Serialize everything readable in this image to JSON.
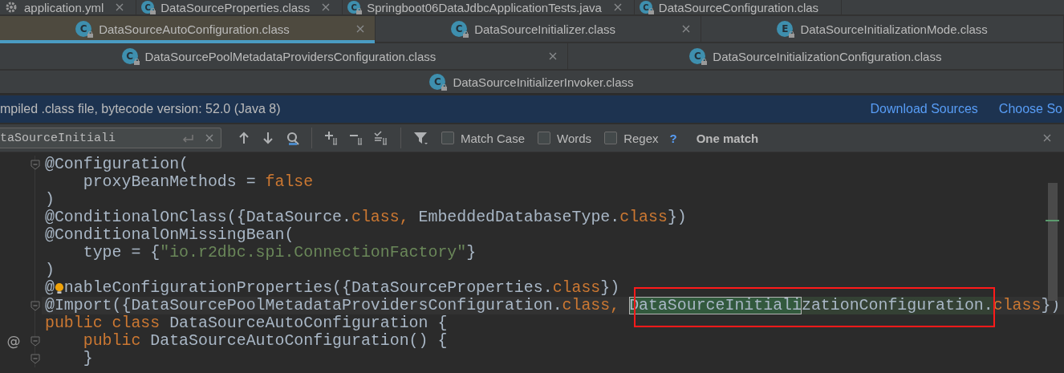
{
  "tab_rows": [
    [
      {
        "label": "application.yml",
        "kind": "config",
        "selected": false,
        "closable": true
      },
      {
        "label": "DataSourceProperties.class",
        "kind": "class",
        "badge": "C",
        "selected": false,
        "closable": true
      },
      {
        "label": "Springboot06DataJdbcApplicationTests.java",
        "kind": "class",
        "badge": "C",
        "selected": false,
        "closable": true
      },
      {
        "label": "DataSourceConfiguration.clas",
        "kind": "class",
        "badge": "C",
        "selected": false,
        "closable": false
      }
    ],
    [
      {
        "label": "DataSourceAutoConfiguration.class",
        "kind": "class",
        "badge": "C",
        "selected": true,
        "closable": true
      },
      {
        "label": "DataSourceInitializer.class",
        "kind": "class",
        "badge": "C",
        "selected": false,
        "closable": true
      },
      {
        "label": "DataSourceInitializationMode.class",
        "kind": "enum",
        "badge": "E",
        "selected": false,
        "closable": false
      }
    ],
    [
      {
        "label": "DataSourcePoolMetadataProvidersConfiguration.class",
        "kind": "class",
        "badge": "C",
        "selected": false,
        "closable": true
      },
      {
        "label": "DataSourceInitializationConfiguration.class",
        "kind": "class",
        "badge": "C",
        "selected": false,
        "closable": false
      }
    ],
    [
      {
        "label": "DataSourceInitializerInvoker.class",
        "kind": "class",
        "badge": "C",
        "selected": false,
        "closable": false
      }
    ]
  ],
  "banner": {
    "message": "mpiled .class file, bytecode version: 52.0 (Java 8)",
    "links": [
      "Download Sources",
      "Choose So"
    ]
  },
  "find_bar": {
    "value": "taSourceInitiali",
    "options": [
      {
        "label": "Match Case",
        "checked": false
      },
      {
        "label": "Words",
        "checked": false
      },
      {
        "label": "Regex",
        "checked": false
      }
    ],
    "help": "?",
    "status": "One match"
  },
  "code": {
    "lines": [
      {
        "fold": true,
        "current": false,
        "tokens": [
          {
            "kind": "plain",
            "text": "@Configuration("
          }
        ]
      },
      {
        "fold": false,
        "current": false,
        "tokens": [
          {
            "kind": "plain",
            "text": "    proxyBeanMethods = "
          },
          {
            "kind": "keyword",
            "text": "false"
          }
        ]
      },
      {
        "fold": false,
        "current": false,
        "tokens": [
          {
            "kind": "plain",
            "text": ")"
          }
        ]
      },
      {
        "fold": false,
        "current": false,
        "tokens": [
          {
            "kind": "plain",
            "text": "@ConditionalOnClass({DataSource."
          },
          {
            "kind": "keyword",
            "text": "class,"
          },
          {
            "kind": "plain",
            "text": " EmbeddedDatabaseType."
          },
          {
            "kind": "keyword",
            "text": "class"
          },
          {
            "kind": "plain",
            "text": "})"
          }
        ]
      },
      {
        "fold": false,
        "current": false,
        "tokens": [
          {
            "kind": "plain",
            "text": "@ConditionalOnMissingBean("
          }
        ]
      },
      {
        "fold": false,
        "current": false,
        "tokens": [
          {
            "kind": "plain",
            "text": "    type = {"
          },
          {
            "kind": "string",
            "text": "\"io.r2dbc.spi.ConnectionFactory\""
          },
          {
            "kind": "plain",
            "text": "}"
          }
        ]
      },
      {
        "fold": false,
        "current": false,
        "tokens": [
          {
            "kind": "plain",
            "text": ")"
          }
        ]
      },
      {
        "fold": false,
        "current": false,
        "tokens": [
          {
            "kind": "plain",
            "text": "@"
          },
          {
            "kind": "bulb"
          },
          {
            "kind": "plain",
            "text": "nableConfigurationProperties({DataSourceProperties."
          },
          {
            "kind": "keyword",
            "text": "class"
          },
          {
            "kind": "plain",
            "text": "})"
          }
        ]
      },
      {
        "fold": true,
        "current": true,
        "tokens": [
          {
            "kind": "plain",
            "text": "@Import({DataSourcePoolMetadataProvidersConfiguration."
          },
          {
            "kind": "keyword",
            "text": "class, "
          },
          {
            "kind": "match",
            "text": "DataSourceInitiali"
          },
          {
            "kind": "occurrence",
            "text": "zationConfiguration."
          },
          {
            "kind": "keyword",
            "text": "class"
          },
          {
            "kind": "plain",
            "text": "})"
          }
        ]
      },
      {
        "fold": false,
        "current": false,
        "tokens": [
          {
            "kind": "keyword",
            "text": "public class"
          },
          {
            "kind": "plain",
            "text": " DataSourceAutoConfiguration {"
          }
        ]
      },
      {
        "fold": true,
        "current": false,
        "gutter": "@",
        "tokens": [
          {
            "kind": "keyword",
            "text": "    public"
          },
          {
            "kind": "plain",
            "text": " DataSourceAutoConfiguration() {"
          }
        ]
      },
      {
        "fold": true,
        "current": false,
        "tokens": [
          {
            "kind": "plain",
            "text": "    }"
          }
        ]
      }
    ]
  }
}
